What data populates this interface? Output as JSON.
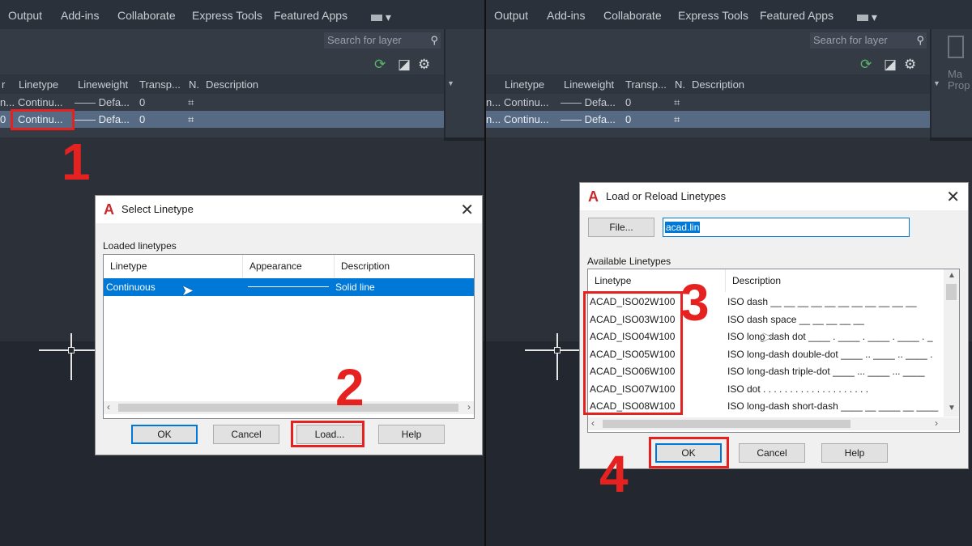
{
  "ribbon": {
    "tabs": [
      "Output",
      "Add-ins",
      "Collaborate",
      "Express Tools",
      "Featured Apps"
    ]
  },
  "layer_manager": {
    "search_placeholder": "Search for layer",
    "columns": [
      "Linetype",
      "Lineweight",
      "Transp...",
      "N.",
      "Description"
    ],
    "rows": [
      {
        "prefix": "n...",
        "linetype": "Continu...",
        "lineweight": "—— Defa...",
        "transparency": "0"
      },
      {
        "prefix": "0",
        "linetype": "Continu...",
        "lineweight": "—— Defa...",
        "transparency": "0"
      }
    ],
    "side_label_1": "Ma",
    "side_label_2": "Prop"
  },
  "select_linetype_dialog": {
    "title": "Select Linetype",
    "section_label": "Loaded linetypes",
    "columns": [
      "Linetype",
      "Appearance",
      "Description"
    ],
    "rows": [
      {
        "linetype": "Continuous",
        "description": "Solid line"
      }
    ],
    "buttons": {
      "ok": "OK",
      "cancel": "Cancel",
      "load": "Load...",
      "help": "Help"
    }
  },
  "load_linetypes_dialog": {
    "title": "Load or Reload Linetypes",
    "file_button": "File...",
    "file_value": "acad.lin",
    "section_label": "Available Linetypes",
    "columns": [
      "Linetype",
      "Description"
    ],
    "rows": [
      {
        "linetype": "ACAD_ISO02W100",
        "description": "ISO dash __ __ __ __ __ __ __ __ __ __ __"
      },
      {
        "linetype": "ACAD_ISO03W100",
        "description": "ISO dash space __    __    __    __    __"
      },
      {
        "linetype": "ACAD_ISO04W100",
        "description": "ISO long-dash dot ____ . ____ . ____ . ____ . _"
      },
      {
        "linetype": "ACAD_ISO05W100",
        "description": "ISO long-dash double-dot ____ .. ____ .. ____ ."
      },
      {
        "linetype": "ACAD_ISO06W100",
        "description": "ISO long-dash triple-dot ____ ... ____ ... ____"
      },
      {
        "linetype": "ACAD_ISO07W100",
        "description": "ISO dot . . . . . . . . . . . . . . . . . . . ."
      },
      {
        "linetype": "ACAD_ISO08W100",
        "description": "ISO long-dash short-dash ____ __ ____ __ ____"
      }
    ],
    "buttons": {
      "ok": "OK",
      "cancel": "Cancel",
      "help": "Help"
    }
  },
  "step_labels": [
    "1",
    "2",
    "3",
    "4"
  ],
  "colors": {
    "highlight": "#e52220",
    "selection": "#0078d7",
    "autocad_red": "#c8292b"
  }
}
